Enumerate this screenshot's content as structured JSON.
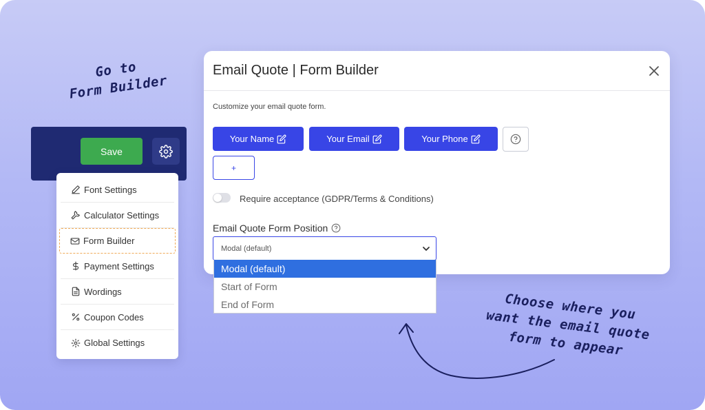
{
  "annotations": {
    "goto_line1": "Go to",
    "goto_line2": "Form Builder",
    "choose_lines": [
      "Choose where you",
      "want the email quote",
      "form to appear"
    ]
  },
  "toolbar": {
    "save_label": "Save",
    "bg_color": "#1f2a72",
    "save_color": "#3daa4f"
  },
  "menu": {
    "items": [
      {
        "label": "Font Settings",
        "icon": "pencil-icon"
      },
      {
        "label": "Calculator Settings",
        "icon": "wrench-icon"
      },
      {
        "label": "Form Builder",
        "icon": "envelope-icon",
        "active": true
      },
      {
        "label": "Payment Settings",
        "icon": "dollar-icon"
      },
      {
        "label": "Wordings",
        "icon": "document-icon"
      },
      {
        "label": "Coupon Codes",
        "icon": "percent-icon"
      },
      {
        "label": "Global Settings",
        "icon": "gear-icon"
      }
    ]
  },
  "modal": {
    "title": "Email Quote | Form Builder",
    "subtitle": "Customize your email quote form.",
    "fields": [
      "Your Name",
      "Your Email",
      "Your Phone"
    ],
    "add_label": "+",
    "toggle_label": "Require acceptance (GDPR/Terms & Conditions)",
    "toggle_on": false,
    "position_label": "Email Quote Form Position",
    "position_value": "Modal (default)",
    "position_options": [
      "Modal (default)",
      "Start of Form",
      "End of Form"
    ],
    "accent_color": "#3845e6",
    "selected_option_color": "#2f6fe0"
  }
}
